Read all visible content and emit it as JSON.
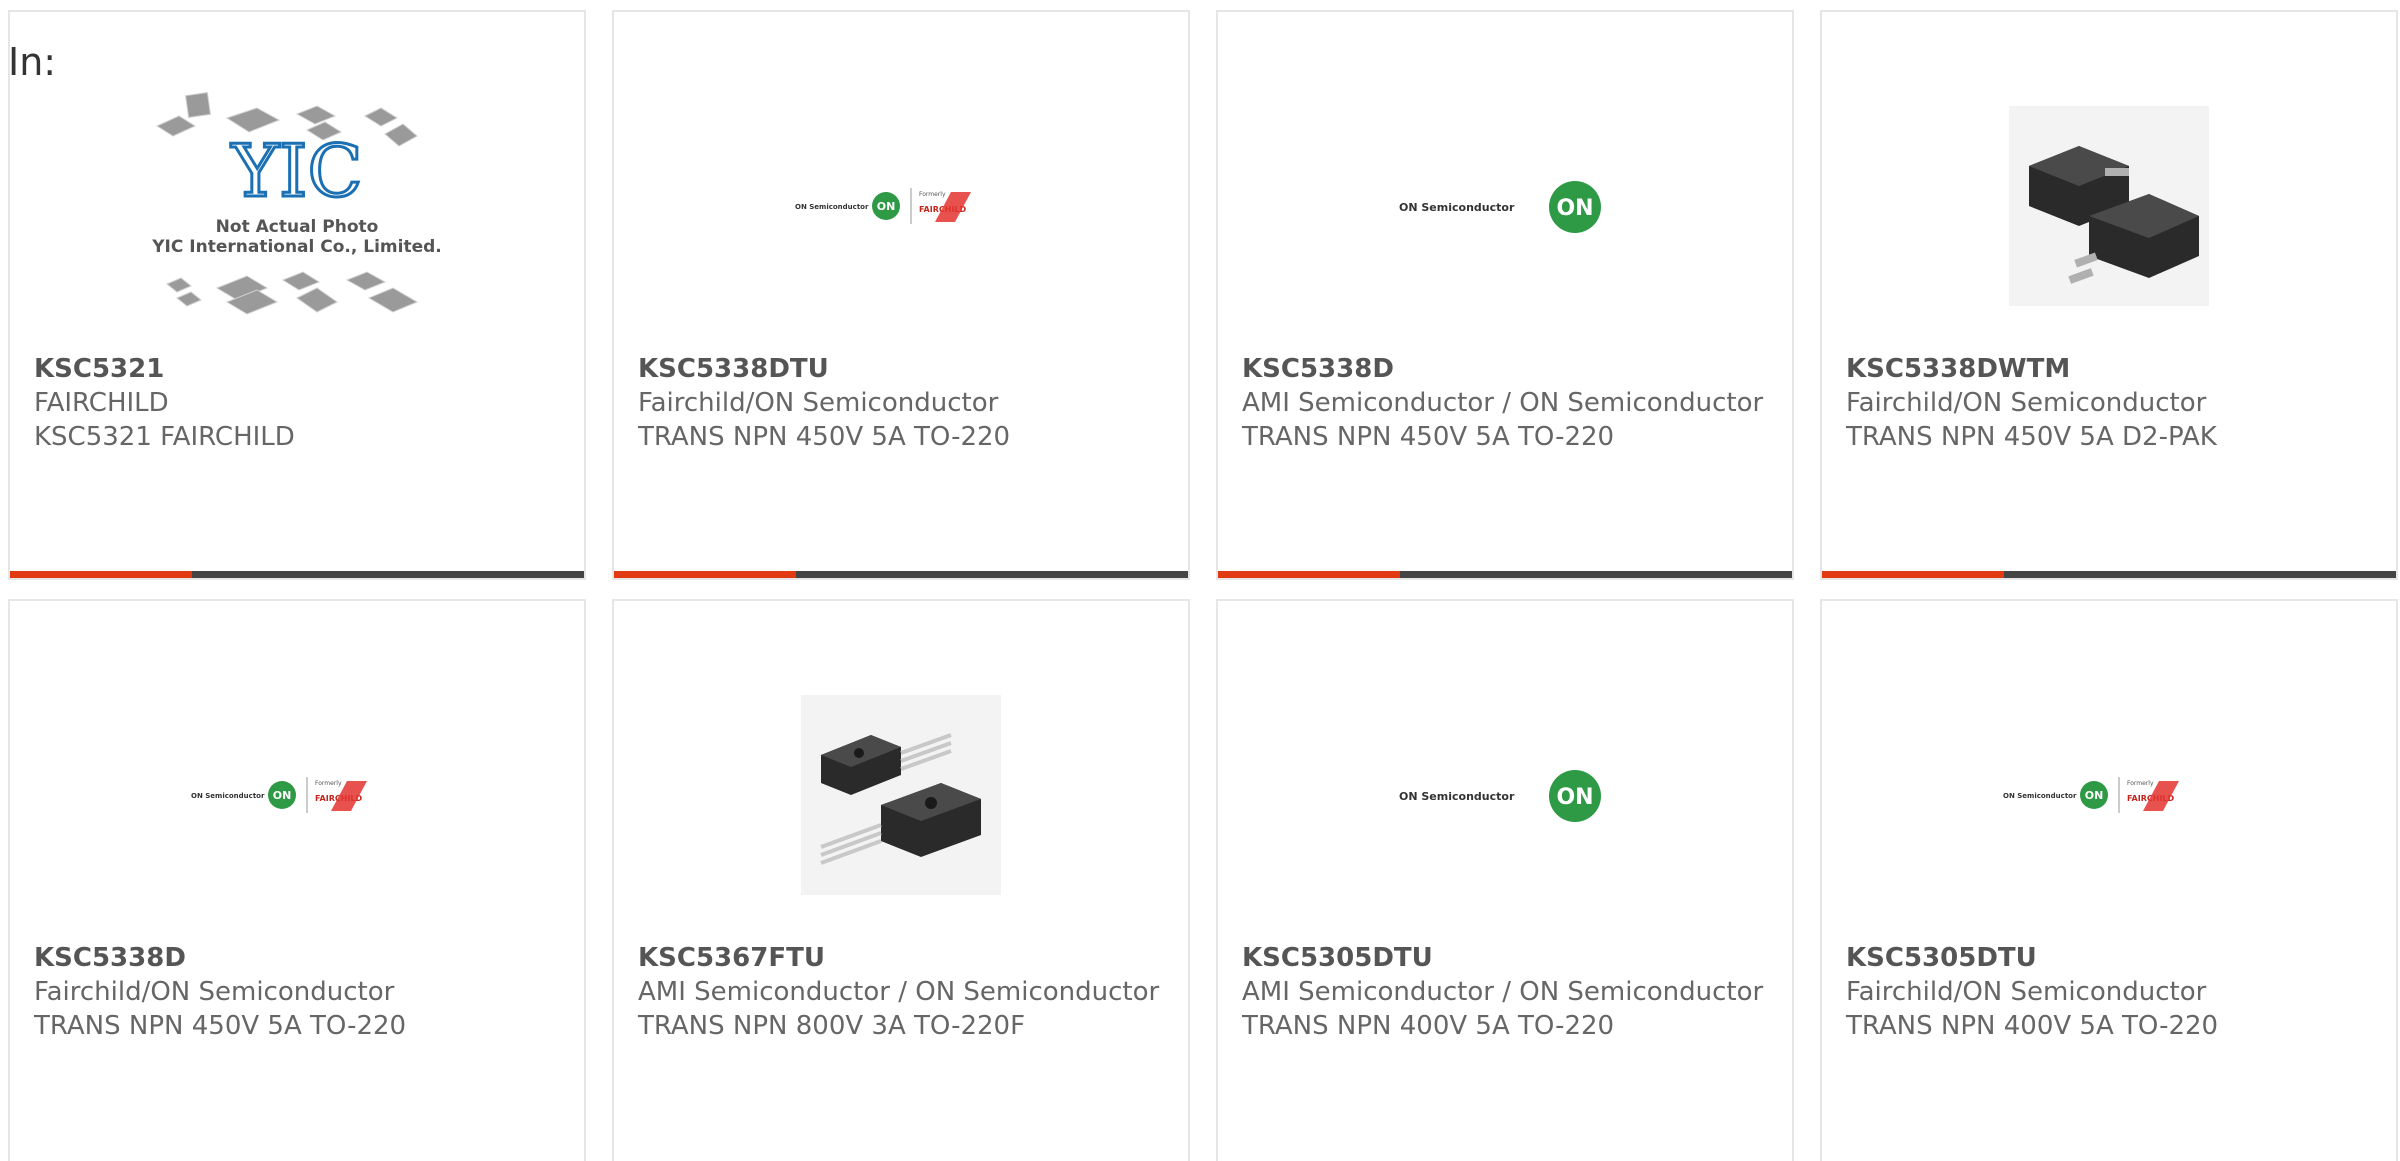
{
  "filter_label": "In:",
  "placeholder_logo": {
    "line1": "Not Actual Photo",
    "line2": "YIC International Co., Limited."
  },
  "logos": {
    "on_semi": "ON Semiconductor",
    "formerly": "Formerly",
    "fairchild": "FAIRCHILD"
  },
  "colors": {
    "accent": "#e13a12",
    "bar": "#444444",
    "on_green": "#2e9a45"
  },
  "products": [
    {
      "part": "KSC5321",
      "maker": "FAIRCHILD",
      "desc": "KSC5321 FAIRCHILD",
      "image": "not-actual-photo"
    },
    {
      "part": "KSC5338DTU",
      "maker": "Fairchild/ON Semiconductor",
      "desc": "TRANS NPN 450V 5A TO-220",
      "image": "on-fairchild-logo"
    },
    {
      "part": "KSC5338D",
      "maker": "AMI Semiconductor / ON Semiconductor",
      "desc": "TRANS NPN 450V 5A TO-220",
      "image": "on-semiconductor-logo"
    },
    {
      "part": "KSC5338DWTM",
      "maker": "Fairchild/ON Semiconductor",
      "desc": "TRANS NPN 450V 5A D2-PAK",
      "image": "d2pak-package"
    },
    {
      "part": "KSC5338D",
      "maker": "Fairchild/ON Semiconductor",
      "desc": "TRANS NPN 450V 5A TO-220",
      "image": "on-fairchild-logo"
    },
    {
      "part": "KSC5367FTU",
      "maker": "AMI Semiconductor / ON Semiconductor",
      "desc": "TRANS NPN 800V 3A TO-220F",
      "image": "to220f-package"
    },
    {
      "part": "KSC5305DTU",
      "maker": "AMI Semiconductor / ON Semiconductor",
      "desc": "TRANS NPN 400V 5A TO-220",
      "image": "on-semiconductor-logo"
    },
    {
      "part": "KSC5305DTU",
      "maker": "Fairchild/ON Semiconductor",
      "desc": "TRANS NPN 400V 5A TO-220",
      "image": "on-fairchild-logo"
    }
  ]
}
